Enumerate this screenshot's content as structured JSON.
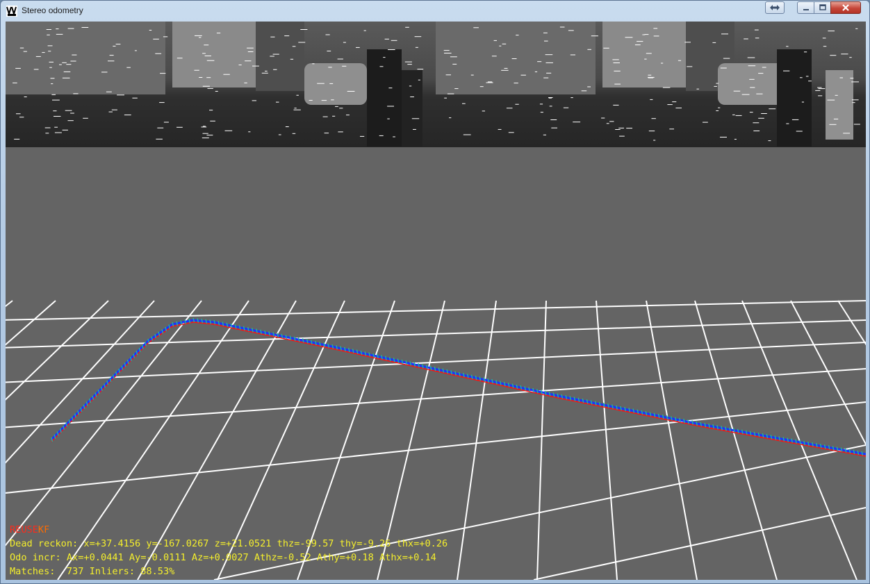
{
  "window": {
    "title": "Stereo odometry"
  },
  "hud": {
    "flags_prefix": "REUSE",
    "flags_suffix": "KF",
    "flags_kf": "KF",
    "dead_reckon": "Dead reckon: x=+37.4156 y=-167.0267 z=+21.0521 thz=-99.57 thy=-9.26 thx=+0.26",
    "odo_incr": "Odo incr: Ax=+0.0441 Ay=-0.0111 Az=+0.0027 Athz=-0.52 Athy=+0.18 Athx=+0.14",
    "matches": "Matches:  737 Inliers: 88.53%"
  },
  "colors": {
    "background": "#646464",
    "grid": "#ffffff",
    "trajectory_ground_truth": "#ff1010",
    "trajectory_estimate": "#1a33ff",
    "trajectory_axis": "#1eb4a0",
    "hud_text": "#f4ee2c",
    "hud_flag": "#ff2a1a"
  },
  "icons": [
    "app-icon",
    "restore-icon",
    "minimize-icon",
    "maximize-icon",
    "close-icon"
  ]
}
